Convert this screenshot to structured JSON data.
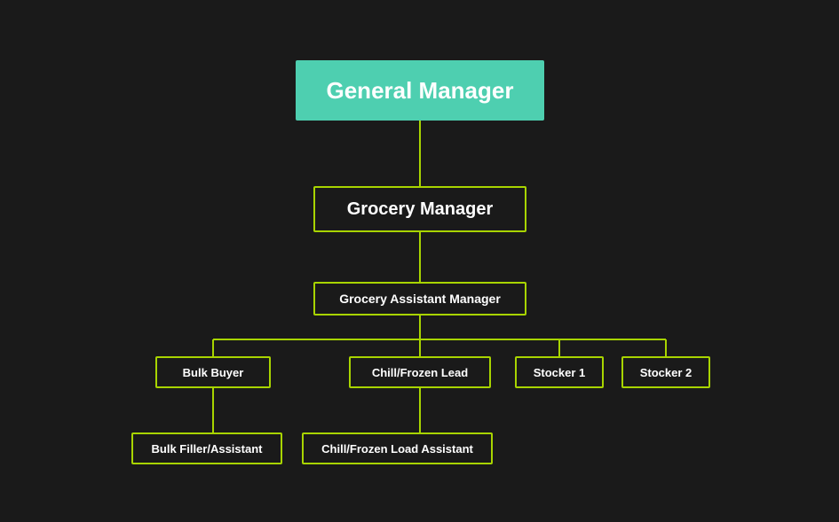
{
  "nodes": {
    "general_manager": {
      "label": "General Manager",
      "bg": "#4ecfb0"
    },
    "grocery_manager": {
      "label": "Grocery Manager"
    },
    "assistant_manager": {
      "label": "Grocery Assistant Manager"
    },
    "bulk_buyer": {
      "label": "Bulk Buyer"
    },
    "chill_lead": {
      "label": "Chill/Frozen Lead"
    },
    "stocker1": {
      "label": "Stocker 1"
    },
    "stocker2": {
      "label": "Stocker 2"
    },
    "bulk_filler": {
      "label": "Bulk Filler/Assistant"
    },
    "chill_assistant": {
      "label": "Chill/Frozen Load Assistant"
    }
  },
  "colors": {
    "background": "#1a1a1a",
    "teal": "#4ecfb0",
    "lime": "#a8d400",
    "text": "#ffffff",
    "connector": "#a8d400"
  }
}
